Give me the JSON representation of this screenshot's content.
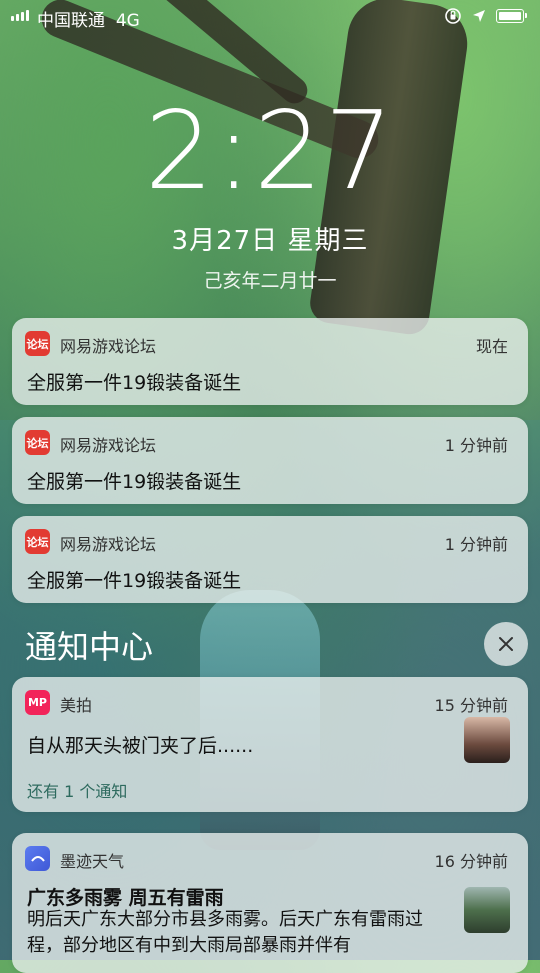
{
  "status_bar": {
    "carrier": "中国联通",
    "network": "4G"
  },
  "lockscreen": {
    "time": "2:27",
    "date": "3月27日 星期三",
    "lunar_date": "己亥年二月廿一"
  },
  "notifications": [
    {
      "app": "网易游戏论坛",
      "time": "现在",
      "message": "全服第一件19锻装备诞生",
      "icon": "netease-forum-icon"
    },
    {
      "app": "网易游戏论坛",
      "time": "1 分钟前",
      "message": "全服第一件19锻装备诞生",
      "icon": "netease-forum-icon"
    },
    {
      "app": "网易游戏论坛",
      "time": "1 分钟前",
      "message": "全服第一件19锻装备诞生",
      "icon": "netease-forum-icon"
    }
  ],
  "notification_center": {
    "title": "通知中心",
    "close_icon": "close-icon",
    "items": [
      {
        "app": "美拍",
        "time": "15 分钟前",
        "message": "自从那天头被门夹了后......",
        "more": "还有 1 个通知",
        "icon": "meipai-icon"
      },
      {
        "app": "墨迹天气",
        "time": "16 分钟前",
        "title": "广东多雨雾 周五有雷雨",
        "message": "明后天广东大部分市县多雨雾。后天广东有雷雨过程，部分地区有中到大雨局部暴雨并伴有",
        "icon": "moji-weather-icon"
      }
    ]
  },
  "forum_icon_text": "论坛",
  "meipai_icon_text": "MP"
}
